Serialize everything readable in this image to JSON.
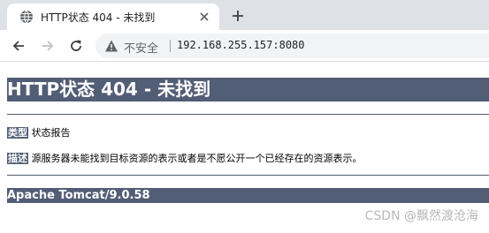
{
  "browser": {
    "tab": {
      "title": "HTTP状态 404 - 未找到",
      "icon": "globe-icon"
    },
    "new_tab_icon": "plus-icon",
    "nav": {
      "back_icon": "arrow-left-icon",
      "forward_icon": "arrow-right-icon",
      "reload_icon": "reload-icon"
    },
    "omnibox": {
      "security_icon": "warning-triangle-icon",
      "security_label": "不安全",
      "url": "192.168.255.157:8080"
    }
  },
  "page": {
    "heading": "HTTP状态 404 - 未找到",
    "type_label": "类型",
    "type_value": "状态报告",
    "description_label": "描述",
    "description_value": "源服务器未能找到目标资源的表示或者是不愿公开一个已经存在的资源表示。",
    "footer": "Apache Tomcat/9.0.58"
  },
  "watermark": "CSDN @飘然渡沧海",
  "colors": {
    "tomcat_banner": "#525d76",
    "chrome_tabstrip": "#dee1e6",
    "omnibox_bg": "#f1f3f4"
  }
}
